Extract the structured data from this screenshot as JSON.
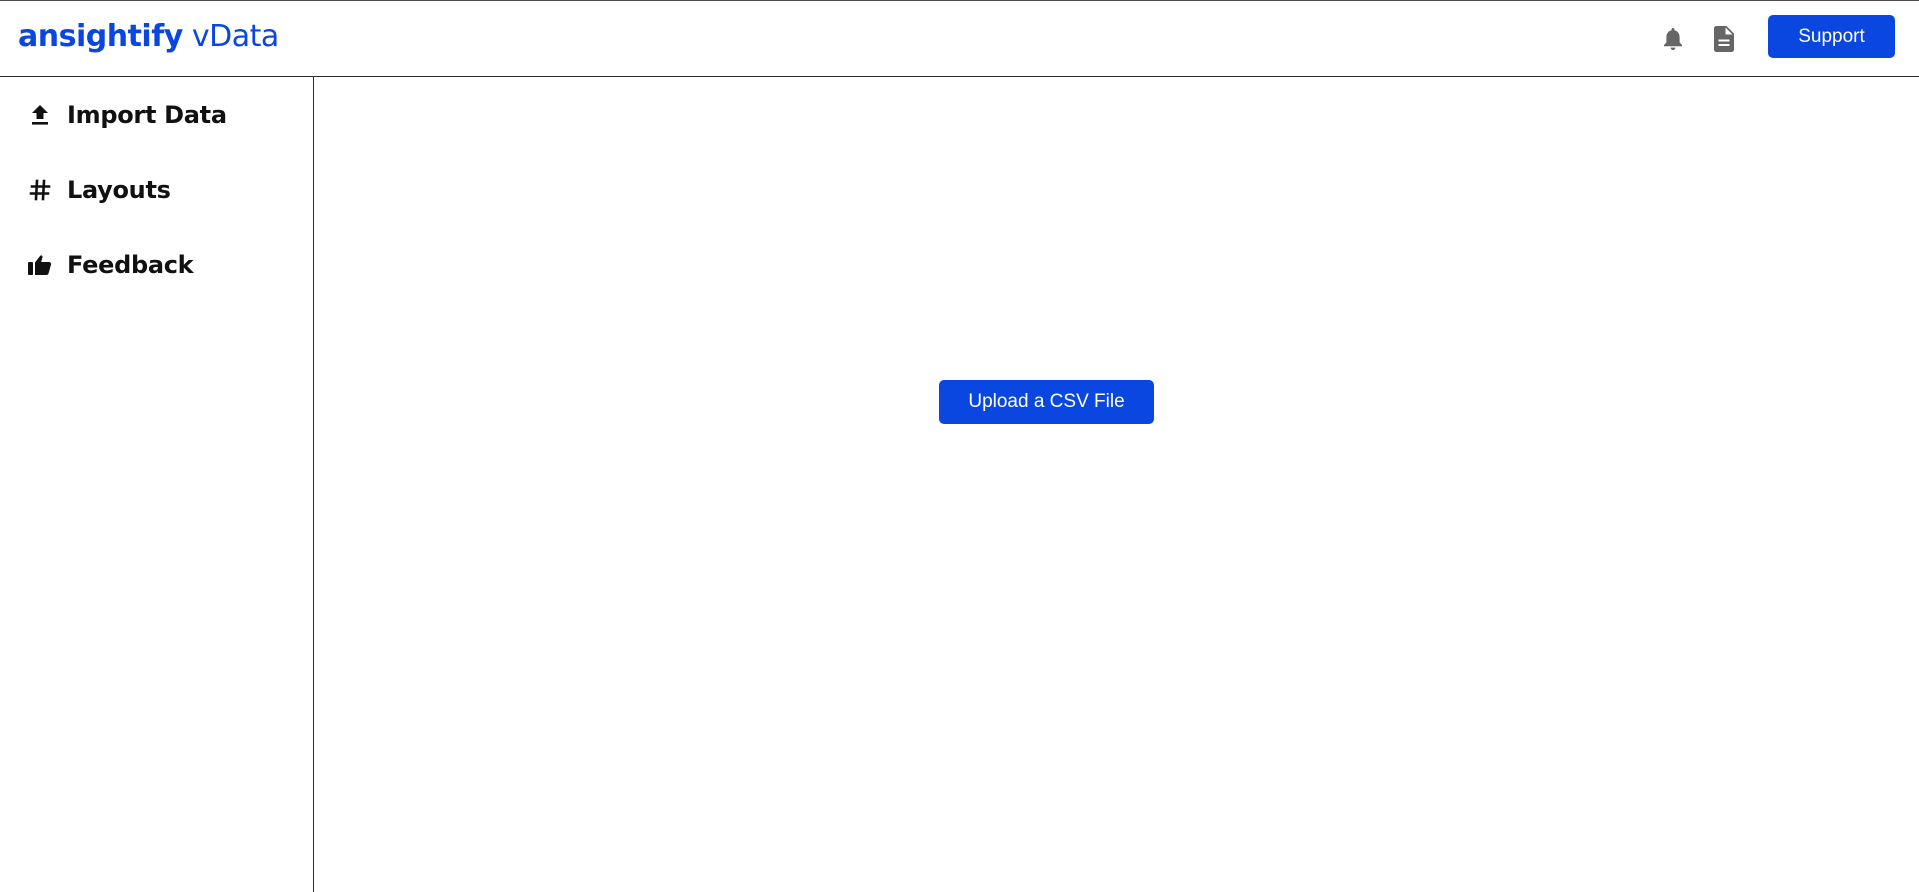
{
  "brand": {
    "name_strong": "ansightify",
    "name_light": "vData"
  },
  "header": {
    "notifications_icon": "bell-icon",
    "docs_icon": "document-icon",
    "support_label": "Support"
  },
  "sidebar": {
    "items": [
      {
        "label": "Import Data",
        "icon": "upload-icon"
      },
      {
        "label": "Layouts",
        "icon": "hash-icon"
      },
      {
        "label": "Feedback",
        "icon": "thumbs-up-icon"
      }
    ]
  },
  "main": {
    "upload_label": "Upload a CSV File"
  },
  "colors": {
    "accent": "#0a47e0",
    "icon_gray": "#666666",
    "text": "#111111"
  }
}
